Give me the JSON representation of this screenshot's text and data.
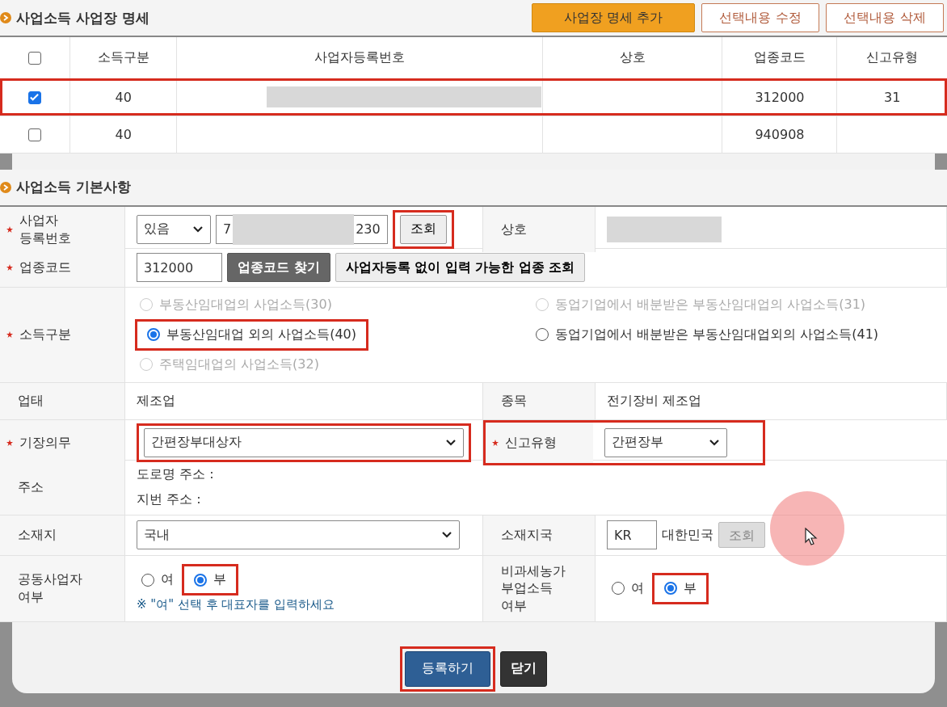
{
  "list_section": {
    "title": "사업소득 사업장 명세",
    "buttons": [
      {
        "label": "사업장 명세 추가",
        "kind": "primary"
      },
      {
        "label": "선택내용 수정",
        "kind": "outline"
      },
      {
        "label": "선택내용 삭제",
        "kind": "outline"
      }
    ]
  },
  "table": {
    "select_all_checked": false,
    "columns": [
      "소득구분",
      "사업자등록번호",
      "상호",
      "업종코드",
      "신고유형"
    ],
    "rows": [
      {
        "checked": true,
        "highlighted": true,
        "redacted": true,
        "cells": [
          "40",
          "",
          "",
          "312000",
          "31"
        ]
      },
      {
        "checked": false,
        "highlighted": false,
        "redacted": false,
        "cells": [
          "40",
          "",
          "",
          "940908",
          ""
        ]
      }
    ]
  },
  "form_section": {
    "title": "사업소득 기본사항"
  },
  "registration": {
    "label": "사업자\n등록번호",
    "required": true,
    "select": "있음",
    "parts": [
      "7",
      "230"
    ],
    "redacted": true,
    "lookup": {
      "label": "조회",
      "highlighted": true
    },
    "name_label": "상호",
    "name_redacted": true
  },
  "industry_code": {
    "label": "업종코드",
    "required": true,
    "value": "312000",
    "buttons": [
      {
        "label": "업종코드 찾기",
        "kind": "dark"
      },
      {
        "label": "사업자등록 없이 입력 가능한 업종 조회",
        "kind": "light"
      }
    ]
  },
  "income_type": {
    "label": "소득구분",
    "required": true,
    "options": [
      {
        "label": "부동산임대업의 사업소득(30)",
        "selected": false,
        "disabled": true,
        "highlighted": false
      },
      {
        "label": "동업기업에서 배분받은 부동산임대업의 사업소득(31)",
        "selected": false,
        "disabled": true,
        "highlighted": false
      },
      {
        "label": "부동산임대업 외의 사업소득(40)",
        "selected": true,
        "disabled": false,
        "highlighted": true
      },
      {
        "label": "동업기업에서 배분받은 부동산임대업외의 사업소득(41)",
        "selected": false,
        "disabled": false,
        "highlighted": false
      },
      {
        "label": "주택임대업의 사업소득(32)",
        "selected": false,
        "disabled": true,
        "highlighted": false
      }
    ]
  },
  "business_type": {
    "label": "업태",
    "value": "제조업"
  },
  "item": {
    "label": "종목",
    "value": "전기장비 제조업"
  },
  "bookkeeping": {
    "label": "기장의무",
    "required": true,
    "value": "간편장부대상자",
    "highlighted": true
  },
  "report_type": {
    "label": "신고유형",
    "required": true,
    "value": "간편장부",
    "highlighted": true
  },
  "address": {
    "label": "주소",
    "lines": [
      "도로명 주소 :",
      "지번 주소 :"
    ]
  },
  "location": {
    "label": "소재지",
    "value": "국내"
  },
  "country": {
    "label": "소재지국",
    "code": "KR",
    "name": "대한민국",
    "button": {
      "label": "조회",
      "disabled": true
    }
  },
  "joint": {
    "label": "공동사업자\n여부",
    "options": [
      {
        "label": "여",
        "selected": false,
        "highlighted": false
      },
      {
        "label": "부",
        "selected": true,
        "highlighted": true
      }
    ],
    "note": "※ \"여\" 선택 후 대표자를 입력하세요"
  },
  "farm": {
    "label": "비과세농가\n부업소득\n여부",
    "options": [
      {
        "label": "여",
        "selected": false,
        "highlighted": false
      },
      {
        "label": "부",
        "selected": true,
        "highlighted": true
      }
    ]
  },
  "footer_buttons": [
    {
      "label": "등록하기",
      "kind": "primary",
      "highlighted": true
    },
    {
      "label": "닫기",
      "kind": "dark",
      "highlighted": false
    }
  ]
}
